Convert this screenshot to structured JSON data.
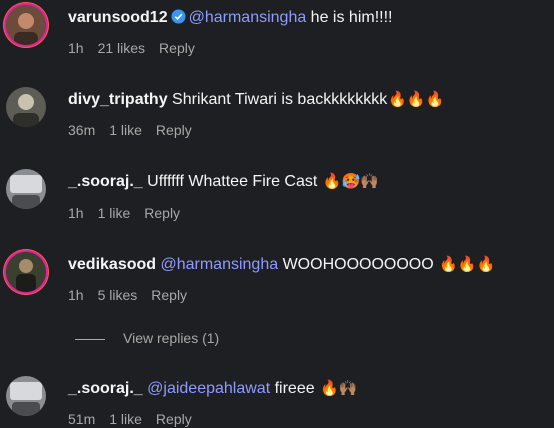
{
  "comments": [
    {
      "username": "varunsood12",
      "verified": true,
      "mention": "@harmansingha",
      "text": " he is him!!!!",
      "emoji": "",
      "time": "1h",
      "likes": "21 likes",
      "reply": "Reply",
      "avatar_colors": [
        "#6b4b3a",
        "#c28a6b",
        "#3a2b22"
      ]
    },
    {
      "username": "divy_tripathy",
      "verified": false,
      "mention": "",
      "text": "Shrikant Tiwari is backkkkkkkk",
      "emoji": "🔥🔥🔥",
      "time": "36m",
      "likes": "1 like",
      "reply": "Reply",
      "avatar_colors": [
        "#5d5d55",
        "#c9c2b0",
        "#2e2e2a"
      ]
    },
    {
      "username": "_.sooraj._",
      "verified": false,
      "mention": "",
      "text": "Uffffff Whattee Fire Cast",
      "emoji": "🔥🥵🙌🏽",
      "time": "1h",
      "likes": "1 like",
      "reply": "Reply",
      "avatar_colors": [
        "#8a8d92",
        "#d7d9dc",
        "#4a4c50"
      ]
    },
    {
      "username": "vedikasood",
      "verified": false,
      "mention": "@harmansingha",
      "text": " WOOHOOOOOOOO",
      "emoji": "🔥🔥🔥",
      "time": "1h",
      "likes": "5 likes",
      "reply": "Reply",
      "avatar_colors": [
        "#3a3f30",
        "#a58c6a",
        "#1c1c18"
      ]
    },
    {
      "username": "_.sooraj._",
      "verified": false,
      "mention": "@jaideepahlawat",
      "text": " fireee",
      "emoji": "🔥🙌🏽",
      "time": "51m",
      "likes": "1 like",
      "reply": "Reply",
      "avatar_colors": [
        "#8a8d92",
        "#d7d9dc",
        "#4a4c50"
      ]
    }
  ],
  "view_replies": "View replies (1)",
  "colors": {
    "background": "#1e1f22",
    "mention": "#8e9bff",
    "secondary_text": "#a8a8a8",
    "verified_blue": "#3897f0"
  }
}
